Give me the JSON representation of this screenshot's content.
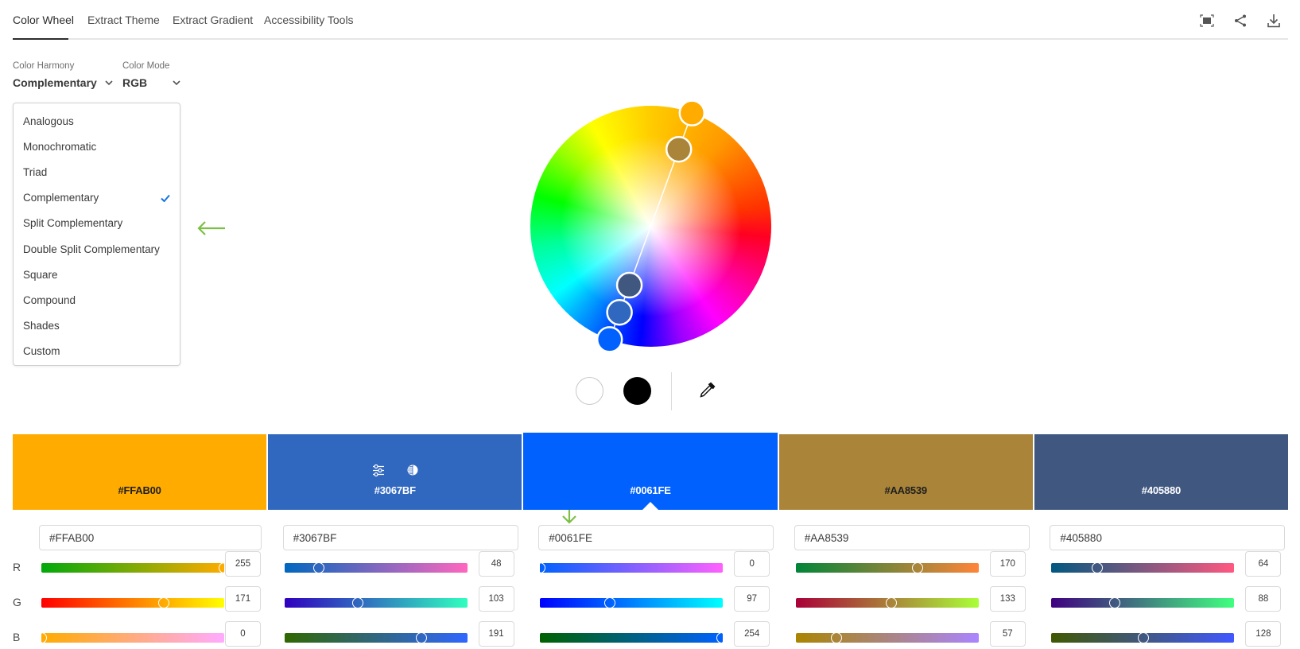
{
  "tabs": [
    {
      "label": "Color Wheel",
      "active": true
    },
    {
      "label": "Extract Theme",
      "active": false
    },
    {
      "label": "Extract Gradient",
      "active": false
    },
    {
      "label": "Accessibility Tools",
      "active": false
    }
  ],
  "top_icons": [
    "fullscreen-icon",
    "share-icon",
    "download-icon"
  ],
  "harmony": {
    "label": "Color Harmony",
    "value": "Complementary"
  },
  "mode": {
    "label": "Color Mode",
    "value": "RGB"
  },
  "harmony_menu": {
    "items": [
      "Analogous",
      "Monochromatic",
      "Triad",
      "Complementary",
      "Split Complementary",
      "Double Split Complementary",
      "Square",
      "Compound",
      "Shades",
      "Custom"
    ],
    "selected": "Complementary"
  },
  "annotations": {
    "arrow_color": "#7cbf45"
  },
  "wheel": {
    "handles": [
      {
        "hex": "#FFAB00",
        "angle_deg": 20,
        "radius": 1.0
      },
      {
        "hex": "#AA8539",
        "angle_deg": 20,
        "radius": 0.68
      },
      {
        "hex": "#405880",
        "angle_deg": 200,
        "radius": 0.52
      },
      {
        "hex": "#3067BF",
        "angle_deg": 200,
        "radius": 0.76
      },
      {
        "hex": "#0061FE",
        "angle_deg": 200,
        "radius": 1.0
      }
    ]
  },
  "tools": {
    "white_label": "white",
    "black_label": "black"
  },
  "swatches": [
    {
      "hex": "#FFAB00",
      "text_color": "#1f1f1f",
      "r": 255,
      "g": 171,
      "b": 0,
      "gradients": {
        "r": [
          "#00a90b",
          "#ffab00"
        ],
        "g": [
          "#ff0000",
          "#ffff00"
        ],
        "b": [
          "#ffab00",
          "#ffabff"
        ]
      }
    },
    {
      "hex": "#3067BF",
      "text_color": "#ffffff",
      "r": 48,
      "g": 103,
      "b": 191,
      "tools": true,
      "gradients": {
        "r": [
          "#0067bf",
          "#ff67bf"
        ],
        "g": [
          "#3000bf",
          "#30ffbf"
        ],
        "b": [
          "#306700",
          "#3067ff"
        ]
      }
    },
    {
      "hex": "#0061FE",
      "text_color": "#ffffff",
      "r": 0,
      "g": 97,
      "b": 254,
      "active": true,
      "gradients": {
        "r": [
          "#0061fe",
          "#ff61fe"
        ],
        "g": [
          "#0000fe",
          "#00fffe"
        ],
        "b": [
          "#006100",
          "#0061ff"
        ]
      }
    },
    {
      "hex": "#AA8539",
      "text_color": "#1f1f1f",
      "r": 170,
      "g": 133,
      "b": 57,
      "gradients": {
        "r": [
          "#008539",
          "#ff8539"
        ],
        "g": [
          "#aa0039",
          "#aaff39"
        ],
        "b": [
          "#aa8500",
          "#aa85ff"
        ]
      }
    },
    {
      "hex": "#405880",
      "text_color": "#ffffff",
      "r": 64,
      "g": 88,
      "b": 128,
      "gradients": {
        "r": [
          "#005880",
          "#ff5880"
        ],
        "g": [
          "#400080",
          "#40ff80"
        ],
        "b": [
          "#405800",
          "#4058ff"
        ]
      }
    }
  ],
  "channel_labels": [
    "R",
    "G",
    "B"
  ]
}
